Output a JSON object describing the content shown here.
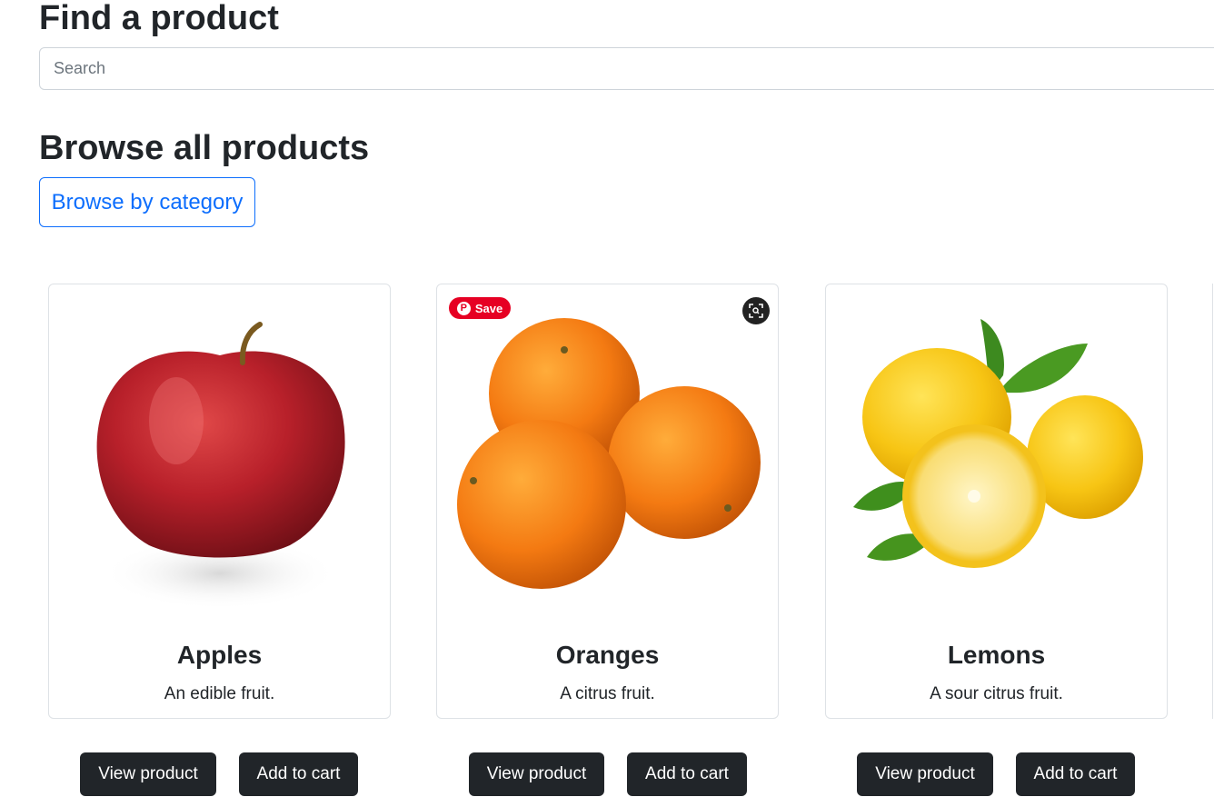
{
  "search": {
    "title": "Find a product",
    "placeholder": "Search"
  },
  "browse": {
    "title": "Browse all products",
    "category_button": "Browse by category"
  },
  "products": [
    {
      "name": "Apples",
      "description": "An edible fruit.",
      "view_label": "View product",
      "cart_label": "Add to cart",
      "image_icon": "apple-image"
    },
    {
      "name": "Oranges",
      "description": "A citrus fruit.",
      "view_label": "View product",
      "cart_label": "Add to cart",
      "image_icon": "oranges-image"
    },
    {
      "name": "Lemons",
      "description": "A sour citrus fruit.",
      "view_label": "View product",
      "cart_label": "Add to cart",
      "image_icon": "lemons-image"
    }
  ],
  "overlay": {
    "pin_save_label": "Save",
    "pin_logo": "P",
    "pin_color": "#e60023",
    "lens_icon": "visual-search-icon"
  },
  "colors": {
    "primary": "#0d6efd",
    "dark_button": "#212529",
    "card_border": "#dee2e6"
  }
}
